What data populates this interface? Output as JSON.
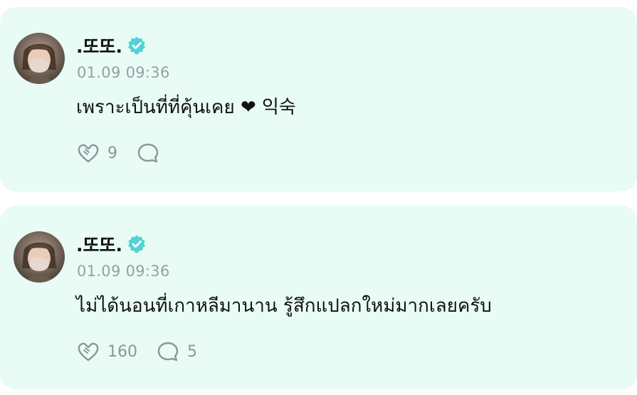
{
  "posts": [
    {
      "author": ".또또.",
      "time": "01.09 09:36",
      "message": "เพราะเป็นที่ที่คุ้นเคย ❤︎ 익숙",
      "reactions": "9",
      "comments": ""
    },
    {
      "author": ".또또.",
      "time": "01.09 09:36",
      "message": "ไม่ได้นอนที่เกาหลีมานาน รู้สึกแปลกใหม่มากเลยครับ",
      "reactions": "160",
      "comments": "5"
    }
  ],
  "colors": {
    "card_bg": "#e8fbf5",
    "verified": "#4fd3d6",
    "muted": "#9a9ea3",
    "text": "#111111"
  },
  "icons": {
    "verified": "verified-badge-icon",
    "reaction": "heart-reaction-icon",
    "comment": "comment-bubble-icon"
  }
}
